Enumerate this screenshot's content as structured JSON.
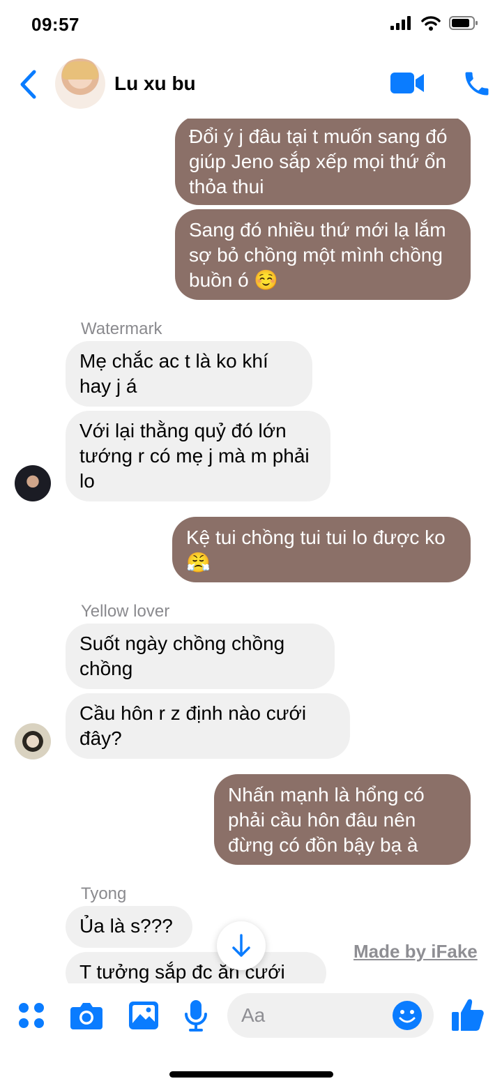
{
  "status_bar": {
    "time": "09:57"
  },
  "header": {
    "contact_name": "Lu xu bu"
  },
  "messages": [
    {
      "id": "m1",
      "direction": "outgoing",
      "text": "Đổi ý j đâu tại t muốn sang đó giúp Jeno sắp xếp mọi thứ ổn thỏa thui"
    },
    {
      "id": "m2",
      "direction": "outgoing",
      "text": "Sang đó nhiều thứ mới lạ lắm sợ bỏ chồng một mình chồng buồn ó ☺️"
    },
    {
      "id": "m3",
      "direction": "incoming",
      "sender": "Watermark",
      "text": "Mẹ chắc ac t là ko khí hay j á"
    },
    {
      "id": "m4",
      "direction": "incoming",
      "text": "Với lại thằng quỷ đó lớn tướng r có mẹ j mà m phải lo"
    },
    {
      "id": "m5",
      "direction": "outgoing",
      "text": "Kệ tui chồng tui tui lo được ko 😤"
    },
    {
      "id": "m6",
      "direction": "incoming",
      "sender": "Yellow lover",
      "text": "Suốt ngày chồng chồng chồng"
    },
    {
      "id": "m7",
      "direction": "incoming",
      "text": "Cầu hôn r z định nào cưới đây?"
    },
    {
      "id": "m8",
      "direction": "outgoing",
      "text": "Nhấn mạnh là hổng có phải cầu hôn đâu nên đừng có đồn bậy bạ à"
    },
    {
      "id": "m9",
      "direction": "incoming",
      "sender": "Tyong",
      "text": "Ủa là s???"
    },
    {
      "id": "m10",
      "direction": "incoming",
      "text": "T tưởng sắp đc ăn cưới"
    }
  ],
  "watermark": "Made by iFake",
  "composer": {
    "placeholder": "Aa"
  },
  "colors": {
    "accent": "#0a7cff",
    "outgoing_bubble": "#8b7068",
    "incoming_bubble": "#f0f0f0"
  }
}
